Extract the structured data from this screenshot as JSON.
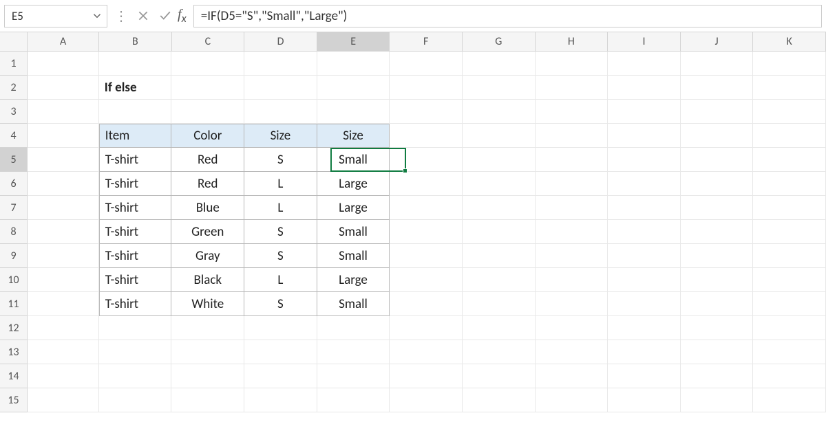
{
  "formulaBar": {
    "nameBox": "E5",
    "formula": "=IF(D5=\"S\",\"Small\",\"Large\")"
  },
  "columns": [
    "A",
    "B",
    "C",
    "D",
    "E",
    "F",
    "G",
    "H",
    "I",
    "J",
    "K"
  ],
  "rowNumbers": [
    "1",
    "2",
    "3",
    "4",
    "5",
    "6",
    "7",
    "8",
    "9",
    "10",
    "11",
    "12",
    "13",
    "14",
    "15"
  ],
  "selectedCell": {
    "col": "E",
    "row": "5"
  },
  "title": "If else",
  "table": {
    "headers": [
      "Item",
      "Color",
      "Size",
      "Size"
    ],
    "rows": [
      [
        "T-shirt",
        "Red",
        "S",
        "Small"
      ],
      [
        "T-shirt",
        "Red",
        "L",
        "Large"
      ],
      [
        "T-shirt",
        "Blue",
        "L",
        "Large"
      ],
      [
        "T-shirt",
        "Green",
        "S",
        "Small"
      ],
      [
        "T-shirt",
        "Gray",
        "S",
        "Small"
      ],
      [
        "T-shirt",
        "Black",
        "L",
        "Large"
      ],
      [
        "T-shirt",
        "White",
        "S",
        "Small"
      ]
    ]
  }
}
